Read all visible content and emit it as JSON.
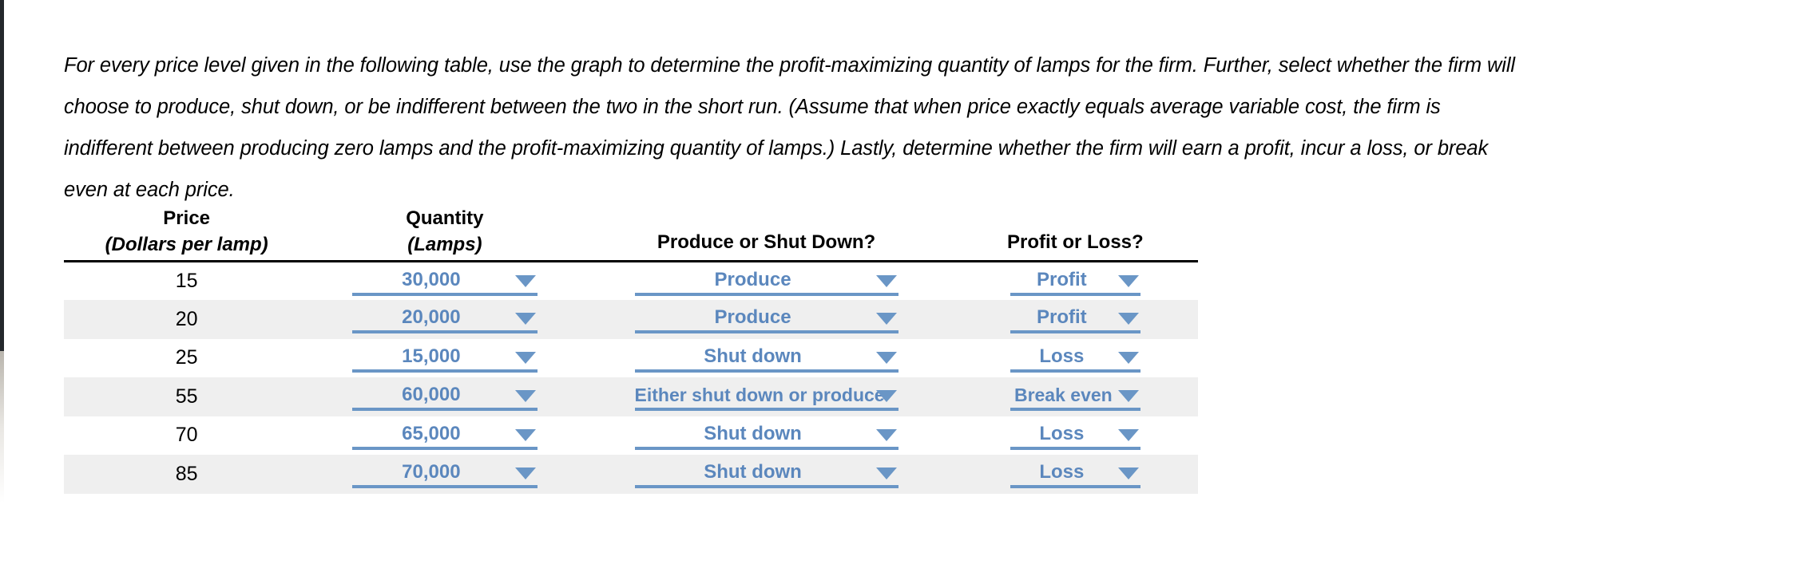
{
  "prompt": {
    "text": "For every price level given in the following table, use the graph to determine the profit-maximizing quantity of lamps for the firm. Further, select whether the firm will choose to produce, shut down, or be indifferent between the two in the short run. (Assume that when price exactly equals average variable cost, the firm is indifferent between producing zero lamps and the profit-maximizing quantity of lamps.) Lastly, determine whether the firm will earn a profit, incur a loss, or break even at each price."
  },
  "table": {
    "headers": {
      "price_top": "Price",
      "price_sub": "(Dollars per lamp)",
      "quantity_top": "Quantity",
      "quantity_sub": "(Lamps)",
      "decision": "Produce or Shut Down?",
      "result": "Profit or Loss?"
    },
    "rows": [
      {
        "price": "15",
        "quantity": "30,000",
        "decision": "Produce",
        "result": "Profit"
      },
      {
        "price": "20",
        "quantity": "20,000",
        "decision": "Produce",
        "result": "Profit"
      },
      {
        "price": "25",
        "quantity": "15,000",
        "decision": "Shut down",
        "result": "Loss"
      },
      {
        "price": "55",
        "quantity": "60,000",
        "decision": "Either shut down or produce",
        "result": "Break even"
      },
      {
        "price": "70",
        "quantity": "65,000",
        "decision": "Shut down",
        "result": "Loss"
      },
      {
        "price": "85",
        "quantity": "70,000",
        "decision": "Shut down",
        "result": "Loss"
      }
    ]
  },
  "colors": {
    "dropdown_blue": "#5b87bd",
    "dropdown_underline": "#6a96c6",
    "row_stripe": "#efefef",
    "text": "#000000"
  },
  "icons": {
    "dropdown_arrow": "chevron-down-icon"
  }
}
